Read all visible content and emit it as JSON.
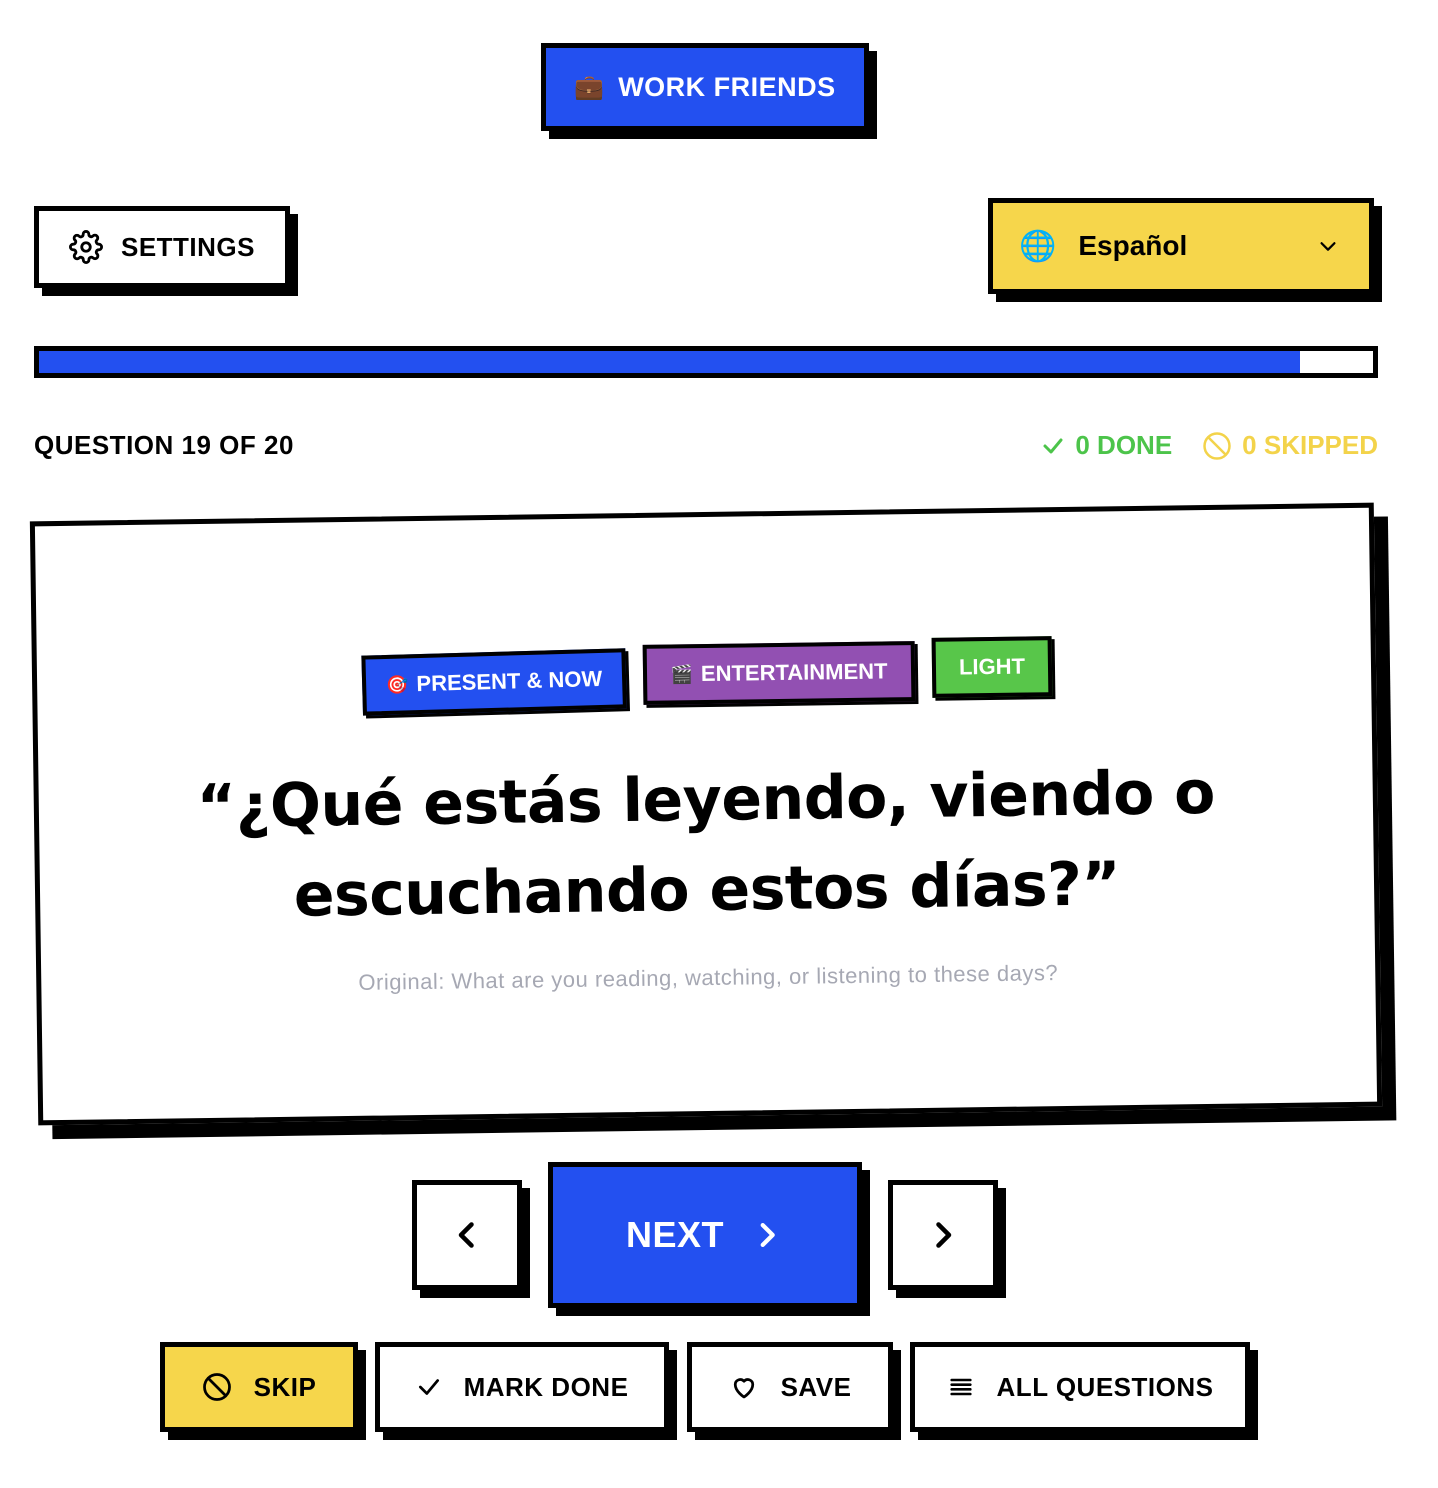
{
  "deck": {
    "emoji": "💼",
    "label": "WORK FRIENDS"
  },
  "header": {
    "settings_label": "SETTINGS",
    "language": {
      "emoji": "🌐",
      "selected": "Español"
    }
  },
  "progress": {
    "current": 19,
    "total": 20,
    "fraction": 0.945,
    "label": "QUESTION 19 OF 20"
  },
  "stats": {
    "done": "0 DONE",
    "skipped": "0 SKIPPED",
    "done_color": "#4cc44a",
    "skipped_color": "#f3d34a"
  },
  "card": {
    "tags": [
      {
        "emoji": "🎯",
        "label": "PRESENT & NOW",
        "color": "#2350f0"
      },
      {
        "emoji": "🎬",
        "label": "ENTERTAINMENT",
        "color": "#9250b2"
      },
      {
        "emoji": "",
        "label": "LIGHT",
        "color": "#58c64a"
      }
    ],
    "question": "“¿Qué estás leyendo, viendo o escuchando estos días?”",
    "original": "Original: What are you reading, watching, or listening to these days?"
  },
  "nav": {
    "next_label": "NEXT"
  },
  "actions": {
    "skip": "SKIP",
    "mark_done": "MARK DONE",
    "save": "SAVE",
    "all_questions": "ALL QUESTIONS"
  },
  "colors": {
    "blue": "#2350f0",
    "yellow": "#f6d64b",
    "purple": "#9250b2",
    "green": "#58c64a"
  },
  "icons": [
    "briefcase-icon",
    "gear-icon",
    "globe-icon",
    "chevron-down-icon",
    "check-icon",
    "ban-icon",
    "chevron-left-icon",
    "chevron-right-icon",
    "heart-icon",
    "list-icon"
  ]
}
